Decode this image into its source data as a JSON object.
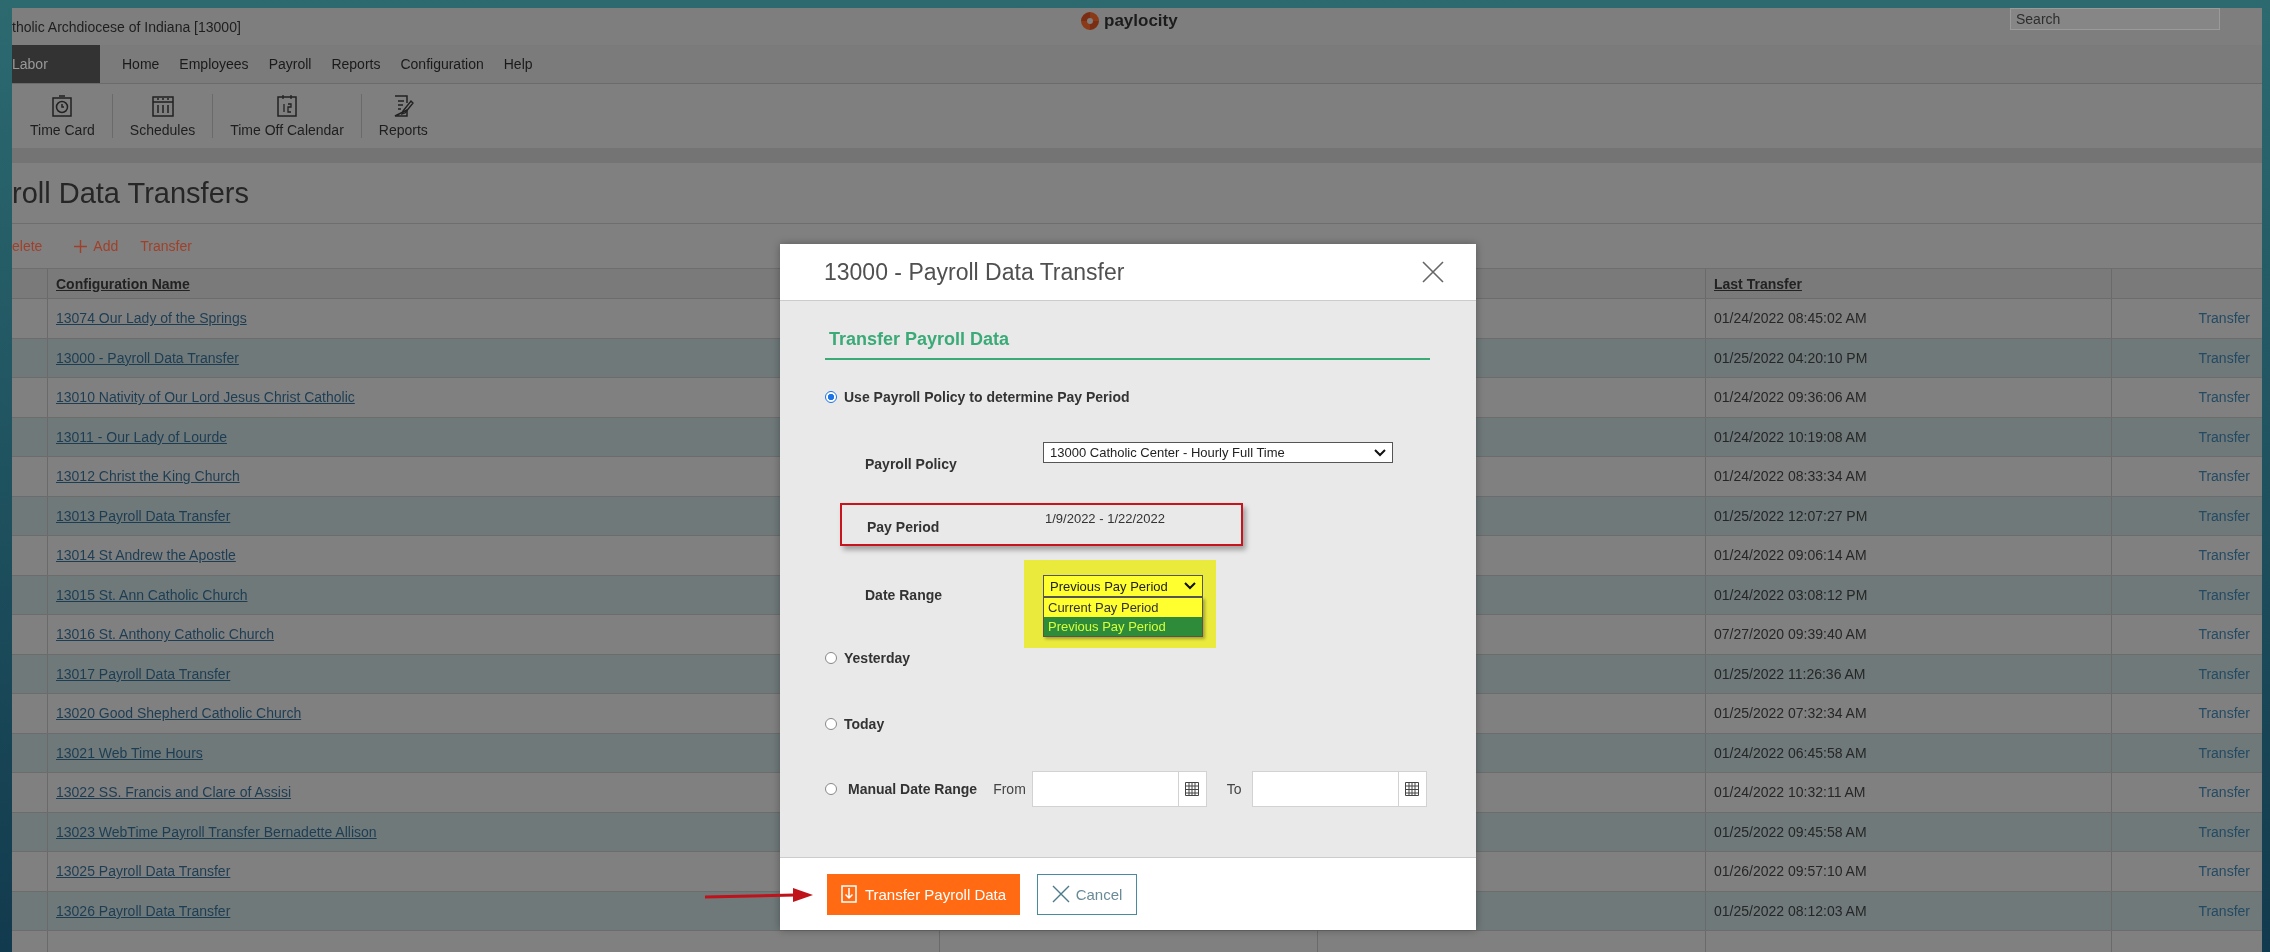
{
  "header": {
    "org": "tholic Archdiocese of Indiana [13000]",
    "logo": "paylocity",
    "search": {
      "placeholder": "Search"
    }
  },
  "nav": {
    "module": "Labor",
    "items": [
      "Home",
      "Employees",
      "Payroll",
      "Reports",
      "Configuration",
      "Help"
    ]
  },
  "toolbar": [
    "Time Card",
    "Schedules",
    "Time Off Calendar",
    "Reports"
  ],
  "page_title": "roll Data Transfers",
  "actions": [
    "elete",
    "Add",
    "Transfer"
  ],
  "table": {
    "columns": [
      "Configuration Name",
      "Last Transfer"
    ],
    "rows": [
      {
        "name": "13074 Our Lady of the Springs",
        "last_transfer": "01/24/2022 08:45:02 AM",
        "action": "Transfer"
      },
      {
        "name": "13000 - Payroll Data Transfer",
        "last_transfer": "01/25/2022 04:20:10 PM",
        "action": "Transfer"
      },
      {
        "name": "13010 Nativity of Our Lord Jesus Christ Catholic",
        "last_transfer": "01/24/2022 09:36:06 AM",
        "action": "Transfer"
      },
      {
        "name": "13011 - Our Lady of Lourde",
        "last_transfer": "01/24/2022 10:19:08 AM",
        "action": "Transfer"
      },
      {
        "name": "13012 Christ the King Church",
        "last_transfer": "01/24/2022 08:33:34 AM",
        "action": "Transfer"
      },
      {
        "name": "13013 Payroll Data Transfer",
        "last_transfer": "01/25/2022 12:07:27 PM",
        "action": "Transfer"
      },
      {
        "name": "13014 St Andrew the Apostle",
        "last_transfer": "01/24/2022 09:06:14 AM",
        "action": "Transfer"
      },
      {
        "name": "13015 St. Ann Catholic Church",
        "last_transfer": "01/24/2022 03:08:12 PM",
        "action": "Transfer"
      },
      {
        "name": "13016 St. Anthony Catholic Church",
        "last_transfer": "07/27/2020 09:39:40 AM",
        "action": "Transfer"
      },
      {
        "name": "13017 Payroll Data Transfer",
        "last_transfer": "01/25/2022 11:26:36 AM",
        "action": "Transfer"
      },
      {
        "name": "13020 Good Shepherd Catholic Church",
        "last_transfer": "01/25/2022 07:32:34 AM",
        "action": "Transfer"
      },
      {
        "name": "13021 Web Time Hours",
        "last_transfer": "01/24/2022 06:45:58 AM",
        "action": "Transfer"
      },
      {
        "name": "13022 SS. Francis and Clare of Assisi",
        "last_transfer": "01/24/2022 10:32:11 AM",
        "action": "Transfer"
      },
      {
        "name": "13023 WebTime Payroll Transfer Bernadette Allison",
        "last_transfer": "01/25/2022 09:45:58 AM",
        "action": "Transfer"
      },
      {
        "name": "13025 Payroll Data Transfer",
        "last_transfer": "01/26/2022 09:57:10 AM",
        "action": "Transfer"
      },
      {
        "name": "13026 Payroll Data Transfer",
        "last_transfer": "01/25/2022 08:12:03 AM",
        "action": "Transfer"
      }
    ]
  },
  "dialog": {
    "title": "13000 - Payroll Data Transfer",
    "section_title": "Transfer Payroll Data",
    "options": [
      {
        "kind": "policy",
        "label": "Use Payroll Policy to determine Pay Period",
        "selected": true
      },
      {
        "kind": "plain",
        "label": "Yesterday",
        "selected": false
      },
      {
        "kind": "plain",
        "label": "Today",
        "selected": false
      },
      {
        "kind": "manual",
        "label": "Manual Date Range",
        "selected": false
      }
    ],
    "payroll_policy": {
      "label": "Payroll Policy",
      "value": "13000 Catholic Center - Hourly Full Time"
    },
    "pay_period": {
      "label": "Pay Period",
      "value": "1/9/2022 - 1/22/2022",
      "highlighted": true
    },
    "date_range": {
      "label": "Date Range",
      "value": "Previous Pay Period",
      "highlighted": true,
      "expanded": true,
      "options": [
        {
          "label": "Current Pay Period",
          "selected": false
        },
        {
          "label": "Previous Pay Period",
          "selected": true
        }
      ]
    },
    "manual": {
      "from_label": "From",
      "to_label": "To"
    },
    "buttons": [
      {
        "kind": "primary",
        "label": "Transfer Payroll Data",
        "pointed": true
      },
      {
        "kind": "secondary",
        "label": "Cancel"
      }
    ]
  }
}
